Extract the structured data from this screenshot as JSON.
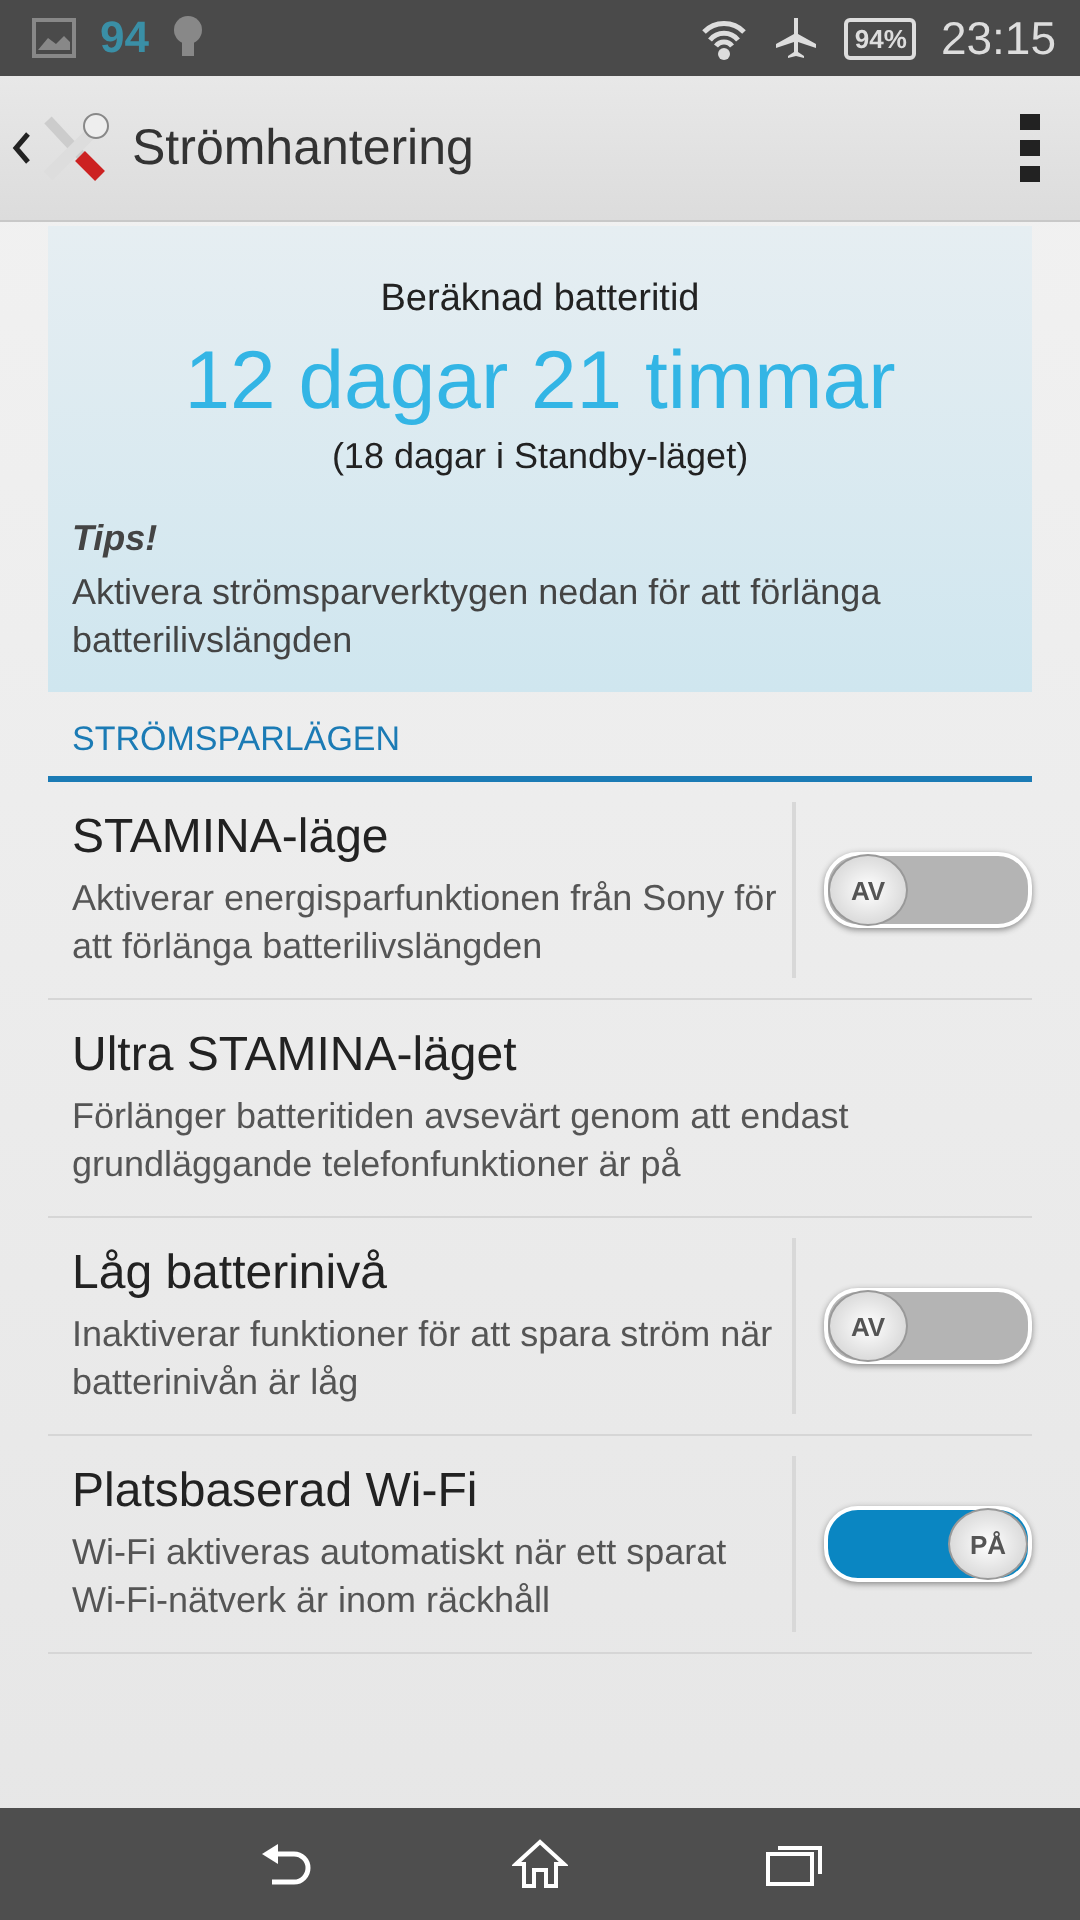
{
  "status_bar": {
    "notification_count": "94",
    "battery": "94%",
    "time": "23:15"
  },
  "action_bar": {
    "title": "Strömhantering"
  },
  "battery_card": {
    "heading": "Beräknad batteritid",
    "estimate": "12 dagar 21 timmar",
    "standby": "(18 dagar i Standby-läget)",
    "tips_title": "Tips!",
    "tips_text": "Aktivera strömsparverktygen nedan för att förlänga batterilivslängden"
  },
  "section": {
    "title": "STRÖMSPARLÄGEN"
  },
  "settings": [
    {
      "kind": "switch",
      "title": "STAMINA-läge",
      "summary": "Aktiverar energisparfunktionen från Sony för att förlänga batterilivslängden",
      "on": false,
      "switch_label": "AV"
    },
    {
      "kind": "plain",
      "title": "Ultra STAMINA-läget",
      "summary": "Förlänger batteritiden avsevärt genom att endast grundläggande telefonfunktioner är på"
    },
    {
      "kind": "switch",
      "title": "Låg batterinivå",
      "summary": "Inaktiverar funktioner för att spara ström när batterinivån är låg",
      "on": false,
      "switch_label": "AV"
    },
    {
      "kind": "switch",
      "title": "Platsbaserad Wi-Fi",
      "summary": "Wi-Fi aktiveras automatiskt när ett sparat Wi-Fi-nätverk är inom räckhåll",
      "on": true,
      "switch_label": "PÅ"
    }
  ]
}
